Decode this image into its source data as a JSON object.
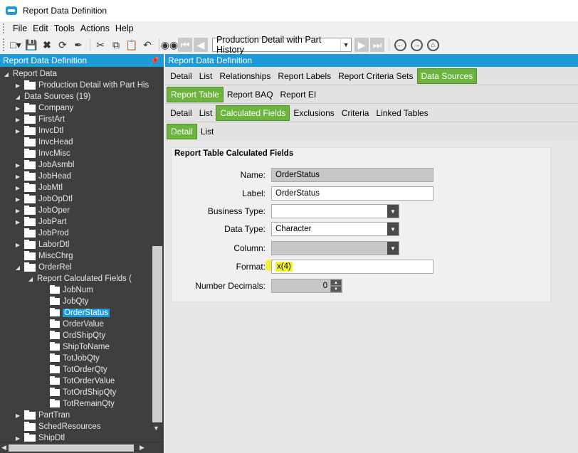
{
  "window": {
    "title": "Report Data Definition"
  },
  "menu": [
    "File",
    "Edit",
    "Tools",
    "Actions",
    "Help"
  ],
  "toolbar": {
    "combo_value": "Production Detail with Part History",
    "icons": [
      "new-icon",
      "save-icon",
      "delete-icon",
      "refresh-icon",
      "clear-icon",
      "cut-icon",
      "copy-icon",
      "paste-icon",
      "undo-icon",
      "binoculars-icon",
      "first-record-icon",
      "previous-record-icon",
      "next-record-icon",
      "last-record-icon",
      "back-icon",
      "forward-icon",
      "home-icon"
    ]
  },
  "left_panel": {
    "title": "Report Data Definition",
    "tree": [
      {
        "label": "Report Data",
        "level": 0,
        "expander": "expanded",
        "folder": false
      },
      {
        "label": "Production Detail with Part His",
        "level": 1,
        "expander": "collapsed",
        "folder": true
      },
      {
        "label": "Data Sources (19)",
        "level": 1,
        "expander": "expanded",
        "folder": false
      },
      {
        "label": "Company",
        "level": 2,
        "expander": "collapsed",
        "folder": true
      },
      {
        "label": "FirstArt",
        "level": 2,
        "expander": "collapsed",
        "folder": true
      },
      {
        "label": "InvcDtl",
        "level": 2,
        "expander": "collapsed",
        "folder": true
      },
      {
        "label": "InvcHead",
        "level": 2,
        "expander": "none",
        "folder": true
      },
      {
        "label": "InvcMisc",
        "level": 2,
        "expander": "none",
        "folder": true
      },
      {
        "label": "JobAsmbl",
        "level": 2,
        "expander": "collapsed",
        "folder": true
      },
      {
        "label": "JobHead",
        "level": 2,
        "expander": "collapsed",
        "folder": true
      },
      {
        "label": "JobMtl",
        "level": 2,
        "expander": "collapsed",
        "folder": true
      },
      {
        "label": "JobOpDtl",
        "level": 2,
        "expander": "collapsed",
        "folder": true
      },
      {
        "label": "JobOper",
        "level": 2,
        "expander": "collapsed",
        "folder": true
      },
      {
        "label": "JobPart",
        "level": 2,
        "expander": "collapsed",
        "folder": true
      },
      {
        "label": "JobProd",
        "level": 2,
        "expander": "none",
        "folder": true
      },
      {
        "label": "LaborDtl",
        "level": 2,
        "expander": "collapsed",
        "folder": true
      },
      {
        "label": "MiscChrg",
        "level": 2,
        "expander": "none",
        "folder": true
      },
      {
        "label": "OrderRel",
        "level": 2,
        "expander": "expanded",
        "folder": true
      },
      {
        "label": "Report Calculated Fields (",
        "level": 3,
        "expander": "expanded",
        "folder": false
      },
      {
        "label": "JobNum",
        "level": 4,
        "expander": "none",
        "folder": true
      },
      {
        "label": "JobQty",
        "level": 4,
        "expander": "none",
        "folder": true
      },
      {
        "label": "OrderStatus",
        "level": 4,
        "expander": "none",
        "folder": true,
        "selected": true
      },
      {
        "label": "OrderValue",
        "level": 4,
        "expander": "none",
        "folder": true
      },
      {
        "label": "OrdShipQty",
        "level": 4,
        "expander": "none",
        "folder": true
      },
      {
        "label": "ShipToName",
        "level": 4,
        "expander": "none",
        "folder": true
      },
      {
        "label": "TotJobQty",
        "level": 4,
        "expander": "none",
        "folder": true
      },
      {
        "label": "TotOrderQty",
        "level": 4,
        "expander": "none",
        "folder": true
      },
      {
        "label": "TotOrderValue",
        "level": 4,
        "expander": "none",
        "folder": true
      },
      {
        "label": "TotOrdShipQty",
        "level": 4,
        "expander": "none",
        "folder": true
      },
      {
        "label": "TotRemainQty",
        "level": 4,
        "expander": "none",
        "folder": true
      },
      {
        "label": "PartTran",
        "level": 2,
        "expander": "collapsed",
        "folder": true
      },
      {
        "label": "SchedResources",
        "level": 2,
        "expander": "none",
        "folder": true
      },
      {
        "label": "ShipDtl",
        "level": 2,
        "expander": "collapsed",
        "folder": true
      }
    ]
  },
  "right_panel": {
    "title": "Report Data Definition",
    "tabs_level1": [
      "Detail",
      "List",
      "Relationships",
      "Report Labels",
      "Report Criteria Sets",
      "Data Sources"
    ],
    "tabs_level1_active": "Data Sources",
    "tabs_level2": [
      "Report Table",
      "Report BAQ",
      "Report EI"
    ],
    "tabs_level2_active": "Report Table",
    "tabs_level3": [
      "Detail",
      "List",
      "Calculated Fields",
      "Exclusions",
      "Criteria",
      "Linked Tables"
    ],
    "tabs_level3_active": "Calculated Fields",
    "tabs_level4": [
      "Detail",
      "List"
    ],
    "tabs_level4_active": "Detail",
    "group_title": "Report Table Calculated Fields",
    "fields": {
      "name": {
        "label": "Name:",
        "value": "OrderStatus"
      },
      "label": {
        "label": "Label:",
        "value": "OrderStatus"
      },
      "business_type": {
        "label": "Business Type:",
        "value": ""
      },
      "data_type": {
        "label": "Data Type:",
        "value": "Character"
      },
      "column": {
        "label": "Column:",
        "value": ""
      },
      "format": {
        "label": "Format:",
        "value": "x(4)"
      },
      "number_decimals": {
        "label": "Number Decimals:",
        "value": "0"
      }
    },
    "highlight_color": "#f4f13a",
    "accent_color": "#1c9bd8",
    "active_tab_color": "#6cb33f"
  }
}
